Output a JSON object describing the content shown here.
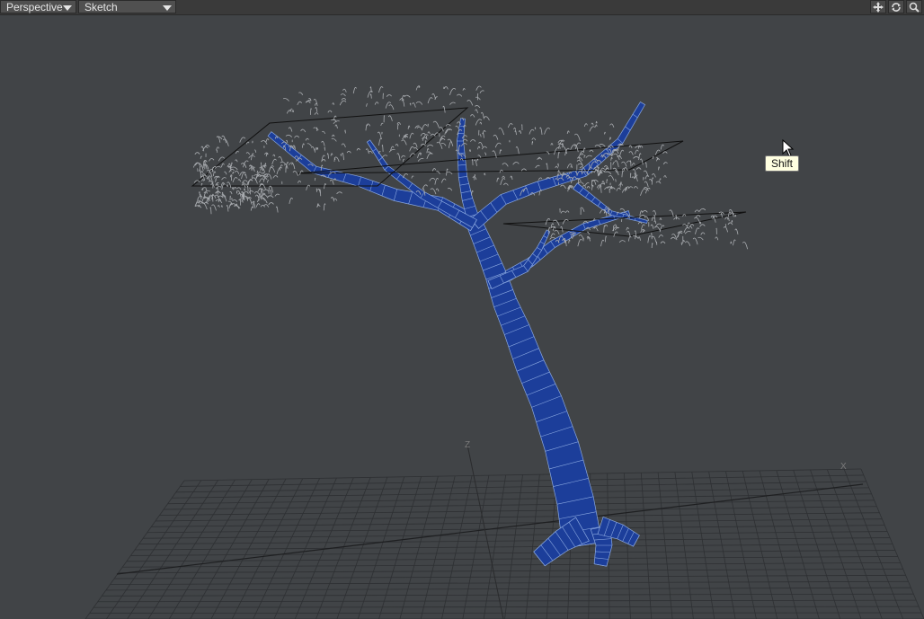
{
  "toolbar": {
    "view_mode": "Perspective",
    "shading_mode": "Sketch",
    "tools": [
      {
        "name": "move-view-icon"
      },
      {
        "name": "rotate-view-icon"
      },
      {
        "name": "zoom-view-icon"
      }
    ]
  },
  "viewport": {
    "axis_labels": {
      "z": "Z",
      "x": "X"
    },
    "tooltip": "Shift",
    "colors": {
      "background": "#414447",
      "grid": "#2e3033",
      "mesh_fill": "#1c3e9a",
      "mesh_wire": "#8aa8e0",
      "foliage": "#a9acb0"
    }
  }
}
